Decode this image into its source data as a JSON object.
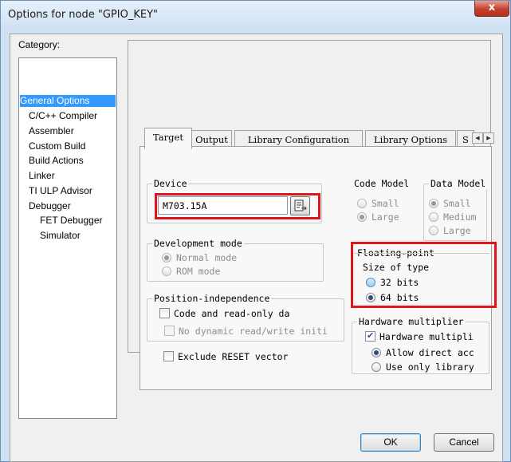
{
  "window": {
    "title": "Options for node \"GPIO_KEY\"",
    "close_glyph": "x"
  },
  "category": {
    "label": "Category:",
    "items": [
      {
        "label": "General Options",
        "selected": true
      },
      {
        "label": "C/C++ Compiler",
        "selected": false
      },
      {
        "label": "Assembler",
        "selected": false
      },
      {
        "label": "Custom Build",
        "selected": false
      },
      {
        "label": "Build Actions",
        "selected": false
      },
      {
        "label": "Linker",
        "selected": false
      },
      {
        "label": "TI ULP Advisor",
        "selected": false
      },
      {
        "label": "Debugger",
        "selected": false
      },
      {
        "label": "FET Debugger",
        "selected": false
      },
      {
        "label": "Simulator",
        "selected": false
      }
    ]
  },
  "tabs": [
    {
      "label": "Target",
      "active": true
    },
    {
      "label": "Output",
      "active": false
    },
    {
      "label": "Library Configuration",
      "active": false
    },
    {
      "label": "Library Options",
      "active": false
    },
    {
      "label": "S",
      "active": false
    }
  ],
  "device": {
    "group_title": "Device",
    "value": "M703.15A"
  },
  "code_model": {
    "title": "Code Model",
    "options": [
      {
        "label": "Small",
        "checked": false
      },
      {
        "label": "Large",
        "checked": true
      }
    ]
  },
  "data_model": {
    "title": "Data Model",
    "options": [
      {
        "label": "Small",
        "checked": true
      },
      {
        "label": "Medium",
        "checked": false
      },
      {
        "label": "Large",
        "checked": false
      }
    ]
  },
  "development_mode": {
    "title": "Development mode",
    "options": [
      {
        "label": "Normal mode",
        "checked": true
      },
      {
        "label": "ROM mode",
        "checked": false
      }
    ]
  },
  "floating_point": {
    "title": "Floating-point",
    "subtitle": "Size of type",
    "options": [
      {
        "label": "32 bits",
        "checked": false
      },
      {
        "label": "64 bits",
        "checked": true
      }
    ]
  },
  "position_independence": {
    "title": "Position-independence",
    "code_readonly": {
      "label": "Code and read-only da",
      "checked": false
    },
    "no_dynamic": {
      "label": "No dynamic read/write initi",
      "checked": false
    }
  },
  "hardware_multiplier": {
    "title": "Hardware multiplier",
    "checkbox": {
      "label": "Hardware multipli",
      "checked": true
    },
    "options": [
      {
        "label": "Allow direct acc",
        "checked": true
      },
      {
        "label": "Use only library",
        "checked": false
      }
    ]
  },
  "exclude_reset": {
    "label": "Exclude RESET vector",
    "checked": false
  },
  "buttons": {
    "ok": "OK",
    "cancel": "Cancel"
  },
  "colors": {
    "highlight": "#e0151b",
    "selection": "#3399ff",
    "title_bar": "#cfe0f3"
  }
}
